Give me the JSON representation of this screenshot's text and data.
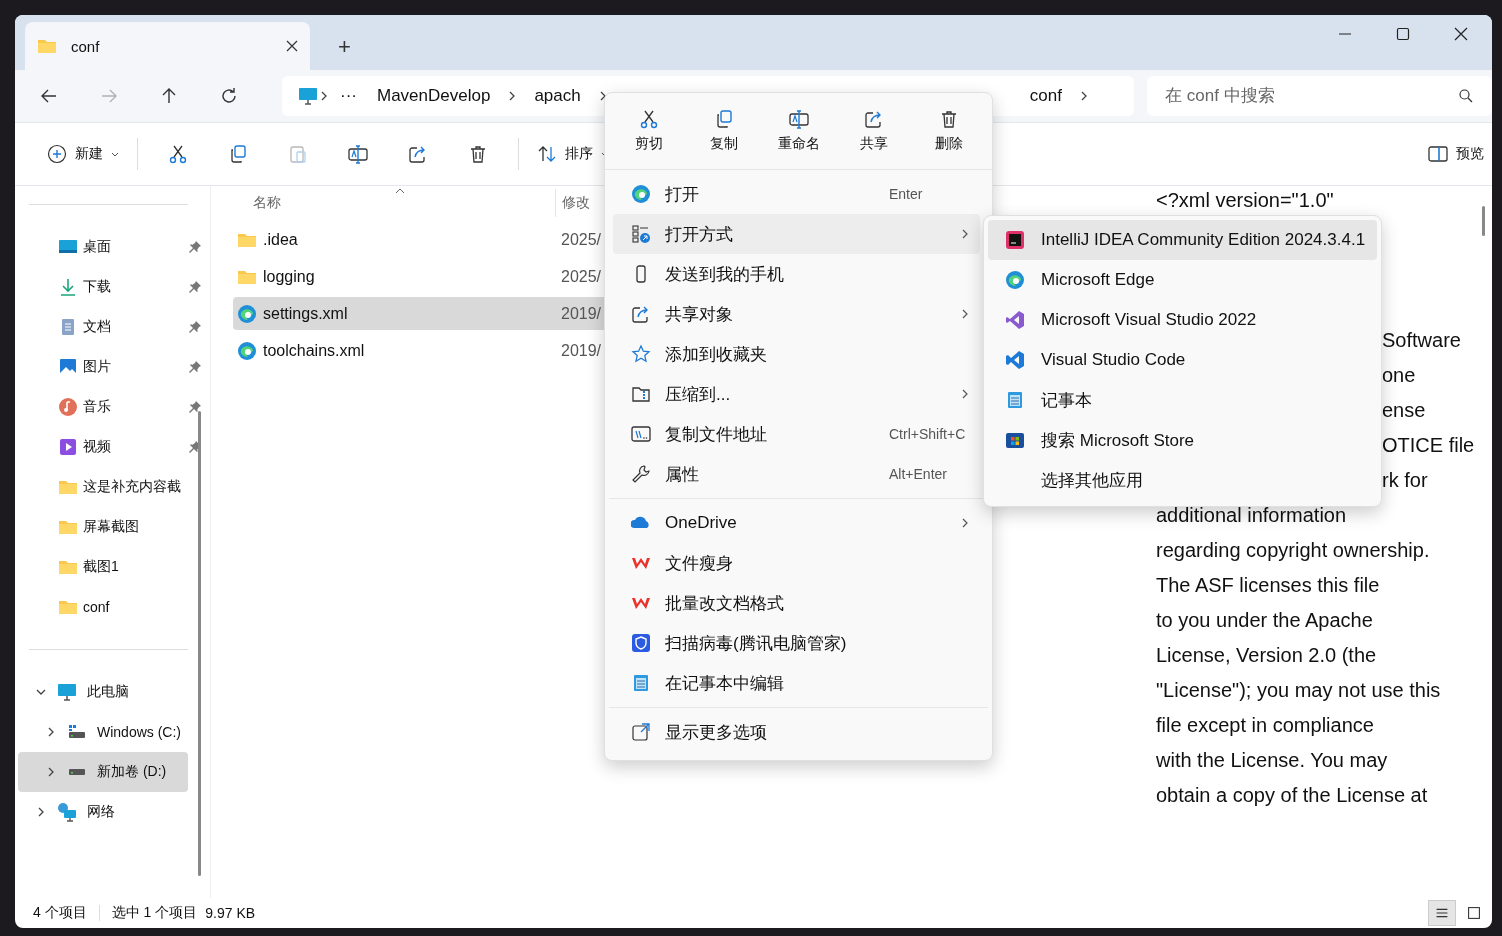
{
  "window": {
    "tab_title": "conf",
    "new_tab": "+"
  },
  "nav": [
    {
      "kind": "back",
      "disabled": false
    },
    {
      "kind": "forward",
      "disabled": true
    },
    {
      "kind": "up",
      "disabled": false
    },
    {
      "kind": "refresh",
      "disabled": false
    }
  ],
  "breadcrumb": {
    "overflow": "···",
    "items": [
      "MavenDevelop",
      "apach",
      "conf"
    ]
  },
  "search": {
    "placeholder": "在 conf 中搜索"
  },
  "toolbar": [
    {
      "kind": "new",
      "label": "新建",
      "disabled": false
    },
    {
      "kind": "cut",
      "disabled": false
    },
    {
      "kind": "copy",
      "disabled": false
    },
    {
      "kind": "paste",
      "disabled": true
    },
    {
      "kind": "rename",
      "disabled": false
    },
    {
      "kind": "share",
      "disabled": false
    },
    {
      "kind": "delete",
      "disabled": false
    },
    {
      "kind": "sort",
      "label": "排序",
      "disabled": false
    }
  ],
  "preview_toggle": "预览",
  "sidebar": {
    "quick_access": [
      {
        "label": "桌面",
        "kind": "desktop",
        "pinned": true
      },
      {
        "label": "下载",
        "kind": "download",
        "pinned": true
      },
      {
        "label": "文档",
        "kind": "docs",
        "pinned": true
      },
      {
        "label": "图片",
        "kind": "pictures",
        "pinned": true
      },
      {
        "label": "音乐",
        "kind": "music",
        "pinned": true
      },
      {
        "label": "视频",
        "kind": "video",
        "pinned": true
      },
      {
        "label": "这是补充内容截",
        "kind": "folder",
        "pinned": false
      },
      {
        "label": "屏幕截图",
        "kind": "folder",
        "pinned": false
      },
      {
        "label": "截图1",
        "kind": "folder",
        "pinned": false
      },
      {
        "label": "conf",
        "kind": "folder",
        "pinned": false
      }
    ],
    "tree": [
      {
        "label": "此电脑",
        "kind": "pc",
        "expanded": true,
        "selected": false,
        "children": [
          {
            "label": "Windows (C:)",
            "kind": "drive-win",
            "expanded": false,
            "selected": false
          },
          {
            "label": "新加卷 (D:)",
            "kind": "drive",
            "expanded": false,
            "selected": true
          }
        ]
      },
      {
        "label": "网络",
        "kind": "network",
        "expanded": false,
        "selected": false
      }
    ]
  },
  "columns": [
    "名称",
    "修改"
  ],
  "files": [
    {
      "name": ".idea",
      "kind": "folder",
      "modified": "2025/",
      "selected": false
    },
    {
      "name": "logging",
      "kind": "folder",
      "modified": "2025/",
      "selected": false
    },
    {
      "name": "settings.xml",
      "kind": "edge",
      "modified": "2019/",
      "selected": true
    },
    {
      "name": "toolchains.xml",
      "kind": "edge",
      "modified": "2019/",
      "selected": false
    }
  ],
  "preview": {
    "first_line": "<?xml version=\"1.0\"",
    "cut_lines": [
      "Software",
      "one",
      "ense",
      "OTICE file",
      "rk for"
    ],
    "lines": [
      "additional information",
      "regarding copyright ownership.",
      "The ASF licenses this file",
      "to you under the Apache",
      "License, Version 2.0 (the",
      "\"License\"); you may not use this",
      "file except in compliance",
      "with the License.  You may",
      "obtain a copy of the License at"
    ]
  },
  "status_bar": {
    "count": "4 个项目",
    "selection": "选中 1 个项目",
    "size": "9.97 KB",
    "views": [
      {
        "kind": "details",
        "selected": true
      },
      {
        "kind": "tiles",
        "selected": false
      }
    ]
  },
  "context_menu": {
    "actions": [
      {
        "kind": "cut",
        "label": "剪切"
      },
      {
        "kind": "copy",
        "label": "复制"
      },
      {
        "kind": "rename",
        "label": "重命名"
      },
      {
        "kind": "share",
        "label": "共享"
      },
      {
        "kind": "delete",
        "label": "删除"
      }
    ],
    "groups": [
      [
        {
          "kind": "edge",
          "label": "打开",
          "shortcut": "Enter",
          "submenu": false,
          "selected": false
        },
        {
          "kind": "open-with",
          "label": "打开方式",
          "submenu": true,
          "selected": true
        },
        {
          "kind": "phone",
          "label": "发送到我的手机",
          "submenu": false,
          "selected": false
        },
        {
          "kind": "share",
          "label": "共享对象",
          "submenu": true,
          "selected": false
        },
        {
          "kind": "star",
          "label": "添加到收藏夹",
          "submenu": false,
          "selected": false
        },
        {
          "kind": "zip",
          "label": "压缩到...",
          "submenu": true,
          "selected": false
        },
        {
          "kind": "path",
          "label": "复制文件地址",
          "shortcut": "Ctrl+Shift+C",
          "submenu": false,
          "selected": false
        },
        {
          "kind": "wrench",
          "label": "属性",
          "shortcut": "Alt+Enter",
          "submenu": false,
          "selected": false
        }
      ],
      [
        {
          "kind": "onedrive",
          "label": "OneDrive",
          "submenu": true,
          "selected": false
        },
        {
          "kind": "wps",
          "label": "文件瘦身",
          "submenu": false,
          "selected": false
        },
        {
          "kind": "wps",
          "label": "批量改文档格式",
          "submenu": false,
          "selected": false
        },
        {
          "kind": "shield",
          "label": "扫描病毒(腾讯电脑管家)",
          "submenu": false,
          "selected": false
        },
        {
          "kind": "notepad",
          "label": "在记事本中编辑",
          "submenu": false,
          "selected": false
        }
      ],
      [
        {
          "kind": "more",
          "label": "显示更多选项",
          "submenu": false,
          "selected": false
        }
      ]
    ]
  },
  "open_with_menu": [
    {
      "kind": "intellij",
      "label": "IntelliJ IDEA Community Edition 2024.3.4.1",
      "selected": true
    },
    {
      "kind": "edge",
      "label": "Microsoft Edge",
      "selected": false
    },
    {
      "kind": "vs",
      "label": "Microsoft Visual Studio 2022",
      "selected": false
    },
    {
      "kind": "vscode",
      "label": "Visual Studio Code",
      "selected": false
    },
    {
      "kind": "notepad",
      "label": "记事本",
      "selected": false
    },
    {
      "kind": "store",
      "label": "搜索 Microsoft Store",
      "selected": false
    },
    {
      "kind": "none",
      "label": "选择其他应用",
      "selected": false
    }
  ]
}
